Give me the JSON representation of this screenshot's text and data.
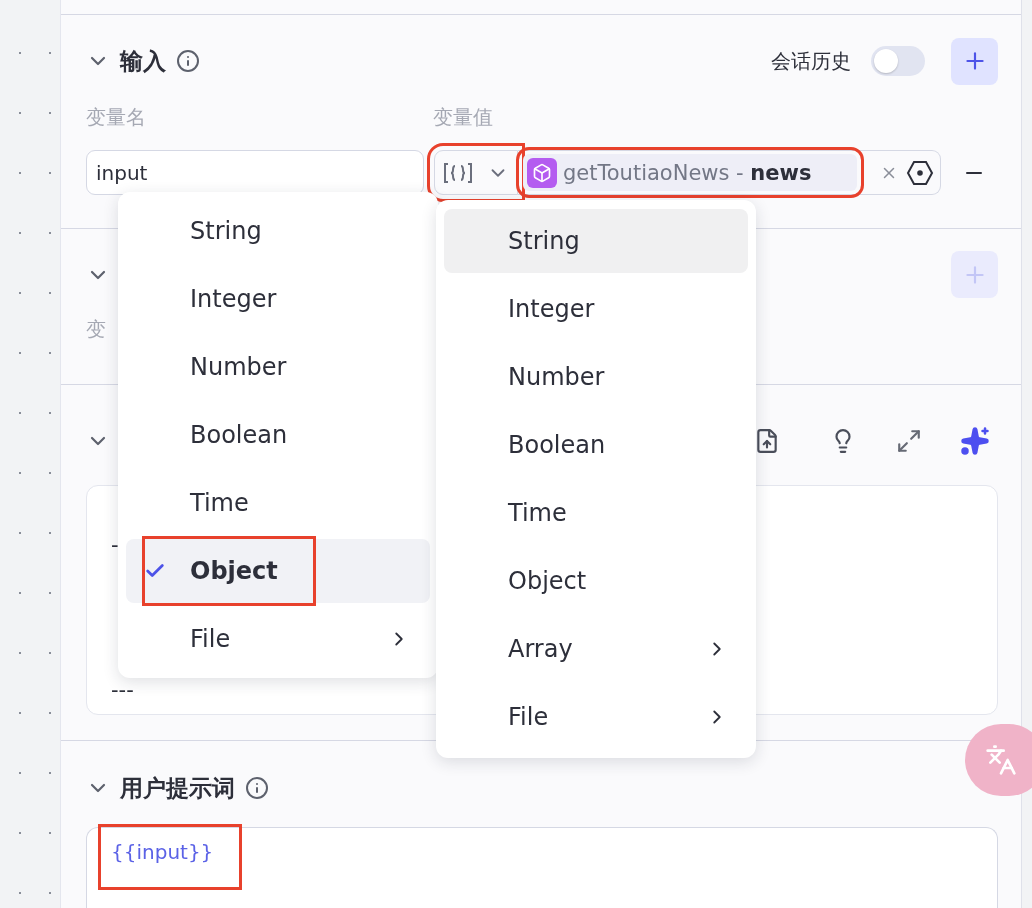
{
  "input_section": {
    "title": "输入",
    "history_label": "会话历史",
    "history_on": false,
    "columns": [
      "变量名",
      "变量值"
    ],
    "rows": [
      {
        "name": "input",
        "type_highlighted": true,
        "source": "getToutiaoNews - **news**",
        "value_highlighted": true
      }
    ]
  },
  "variables_section": {
    "label": "变",
    "add_disabled": true
  },
  "system_prompt_section": {
    "lines": [
      {
        "kind": "covered"
      },
      {
        "kind": "text",
        "text": "-"
      },
      {
        "kind": "covered"
      },
      {
        "kind": "covered"
      },
      {
        "kind": "covered"
      },
      {
        "kind": "text",
        "text": "---"
      }
    ]
  },
  "user_prompt_section": {
    "title": "用户提示词",
    "text": "{{input}}",
    "highlighted": true
  },
  "type_menus": [
    {
      "items": [
        {
          "label": "String",
          "selected": false,
          "hovered": false,
          "submenu": false
        },
        {
          "label": "Integer",
          "selected": false,
          "hovered": false,
          "submenu": false
        },
        {
          "label": "Number",
          "selected": false,
          "hovered": false,
          "submenu": false
        },
        {
          "label": "Boolean",
          "selected": false,
          "hovered": false,
          "submenu": false
        },
        {
          "label": "Time",
          "selected": false,
          "hovered": false,
          "submenu": false
        },
        {
          "label": "Object",
          "selected": true,
          "hovered": false,
          "submenu": false,
          "highlighted": true
        },
        {
          "label": "File",
          "selected": false,
          "hovered": false,
          "submenu": true
        }
      ]
    },
    {
      "items": [
        {
          "label": "String",
          "selected": false,
          "hovered": true,
          "submenu": false
        },
        {
          "label": "Integer",
          "selected": false,
          "hovered": false,
          "submenu": false
        },
        {
          "label": "Number",
          "selected": false,
          "hovered": false,
          "submenu": false
        },
        {
          "label": "Boolean",
          "selected": false,
          "hovered": false,
          "submenu": false
        },
        {
          "label": "Time",
          "selected": false,
          "hovered": false,
          "submenu": false
        },
        {
          "label": "Object",
          "selected": false,
          "hovered": false,
          "submenu": false
        },
        {
          "label": "Array",
          "selected": false,
          "hovered": false,
          "submenu": true
        },
        {
          "label": "File",
          "selected": false,
          "hovered": false,
          "submenu": true
        }
      ]
    }
  ]
}
